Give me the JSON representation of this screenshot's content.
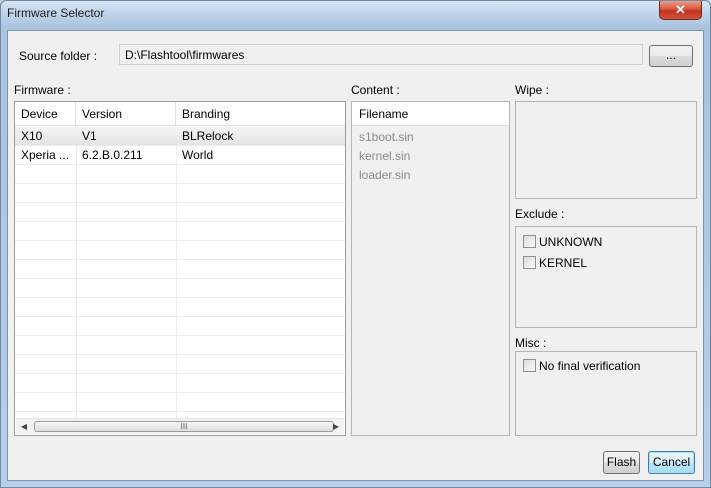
{
  "window": {
    "title": "Firmware Selector",
    "close_label": "✕"
  },
  "source": {
    "label": "Source folder :",
    "path": "D:\\Flashtool\\firmwares",
    "browse_label": "..."
  },
  "firmware": {
    "label": "Firmware :",
    "columns": [
      "Device",
      "Version",
      "Branding"
    ],
    "rows": [
      {
        "device": "X10",
        "version": "V1",
        "branding": "BLRelock"
      },
      {
        "device": "Xperia ...",
        "version": "6.2.B.0.211",
        "branding": "World"
      }
    ],
    "scroll_grip": "III"
  },
  "content": {
    "label": "Content :",
    "column": "Filename",
    "files": [
      "s1boot.sin",
      "kernel.sin",
      "loader.sin"
    ]
  },
  "wipe": {
    "label": "Wipe :"
  },
  "exclude": {
    "label": "Exclude :",
    "items": [
      "UNKNOWN",
      "KERNEL"
    ]
  },
  "misc": {
    "label": "Misc :",
    "items": [
      "No final verification"
    ]
  },
  "buttons": {
    "flash": "Flash",
    "cancel": "Cancel"
  }
}
